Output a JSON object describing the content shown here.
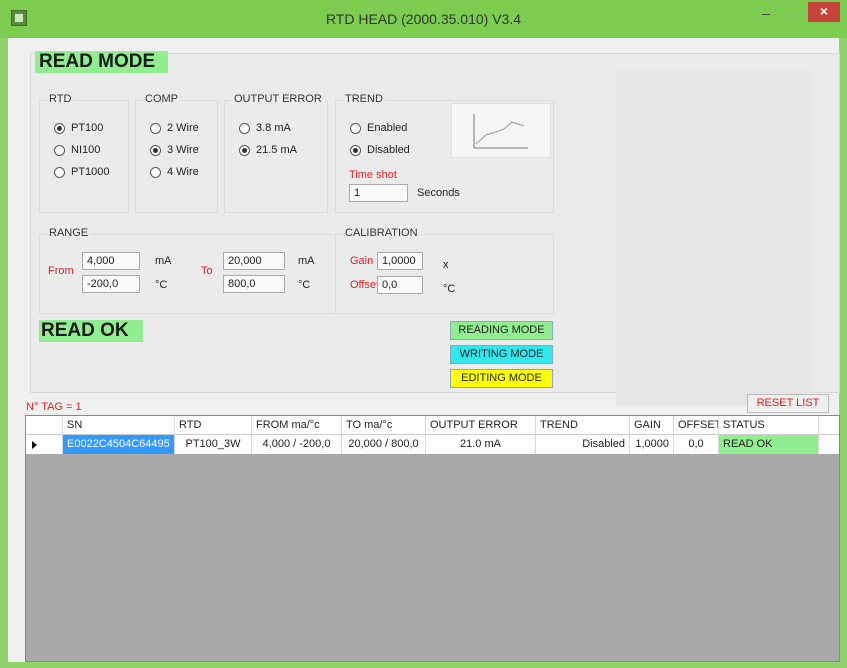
{
  "window": {
    "title": "RTD HEAD  (2000.35.010)  V3.4",
    "minimize": "–",
    "maximize": "□",
    "close": "×"
  },
  "mode_label": "READ MODE",
  "status_label": "READ OK",
  "rtd": {
    "title": "RTD",
    "options": [
      "PT100",
      "NI100",
      "PT1000"
    ],
    "selected": "PT100"
  },
  "comp": {
    "title": "COMP",
    "options": [
      "2 Wire",
      "3 Wire",
      "4 Wire"
    ],
    "selected": "3 Wire"
  },
  "output_error": {
    "title": "OUTPUT ERROR",
    "options": [
      "3.8 mA",
      "21.5 mA"
    ],
    "selected": "21.5 mA"
  },
  "trend": {
    "title": "TREND",
    "options": [
      "Enabled",
      "Disabled"
    ],
    "selected": "Disabled",
    "time_shot_label": "Time shot",
    "time_shot_value": "1",
    "seconds_label": "Seconds"
  },
  "range": {
    "title": "RANGE",
    "from_label": "From",
    "to_label": "To",
    "from_ma": "4,000",
    "from_c": "-200,0",
    "to_ma": "20,000",
    "to_c": "800,0",
    "unit_ma": "mA",
    "unit_c": "°C"
  },
  "calibration": {
    "title": "CALIBRATION",
    "gain_label": "Gain",
    "gain_value": "1,0000",
    "gain_unit": "x",
    "offset_label": "Offset",
    "offset_value": "0,0",
    "offset_unit": "°C"
  },
  "buttons": {
    "reading_mode": "READING MODE",
    "writing_mode": "WRITING MODE",
    "editing_mode": "EDITING MODE",
    "reset_list": "RESET LIST"
  },
  "tag_count": "N° TAG = 1",
  "table": {
    "headers": [
      "SN",
      "RTD",
      "FROM ma/°c",
      "TO ma/°c",
      "OUTPUT ERROR",
      "TREND",
      "GAIN",
      "OFFSET",
      "STATUS"
    ],
    "rows": [
      {
        "sn": "E0022C4504C64495",
        "rtd": "PT100_3W",
        "from": "4,000 / -200,0",
        "to": "20,000 / 800,0",
        "output_error": "21.0 mA",
        "trend": "Disabled",
        "gain": "1,0000",
        "offset": "0,0",
        "status": "READ OK"
      }
    ]
  },
  "colors": {
    "title_bar": "#7ccd4f",
    "mode_green": "#90ee90",
    "writing_cyan": "#2fe8ee",
    "editing_yellow": "#ffff00",
    "label_red": "#dd2222",
    "selection_blue": "#3399ff"
  }
}
